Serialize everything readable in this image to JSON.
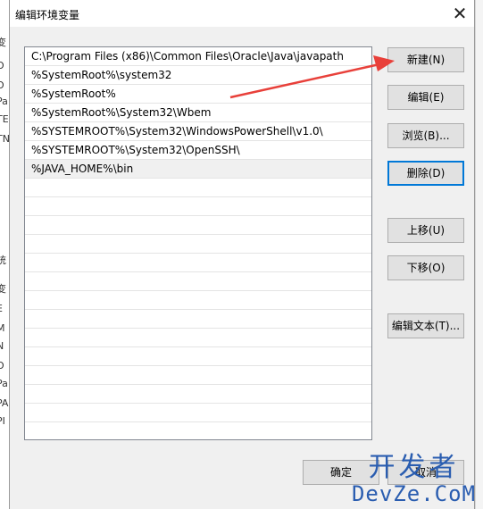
{
  "background_left": [
    "变",
    "O",
    "O",
    "Pa",
    "TE",
    "TN",
    "统",
    "变",
    "E",
    "M",
    "N",
    "O",
    "Pa",
    "PA",
    "PI"
  ],
  "dialog": {
    "title": "编辑环境变量",
    "close_label": "✕",
    "paths": [
      "C:\\Program Files (x86)\\Common Files\\Oracle\\Java\\javapath",
      "%SystemRoot%\\system32",
      "%SystemRoot%",
      "%SystemRoot%\\System32\\Wbem",
      "%SYSTEMROOT%\\System32\\WindowsPowerShell\\v1.0\\",
      "%SYSTEMROOT%\\System32\\OpenSSH\\",
      "%JAVA_HOME%\\bin",
      "",
      "",
      "",
      "",
      "",
      "",
      "",
      "",
      "",
      "",
      "",
      "",
      "",
      ""
    ],
    "buttons": {
      "new": "新建(N)",
      "edit": "编辑(E)",
      "browse": "浏览(B)...",
      "delete": "删除(D)",
      "move_up": "上移(U)",
      "move_down": "下移(O)",
      "edit_text": "编辑文本(T)..."
    },
    "ok": "确定",
    "cancel": "取消"
  },
  "watermark": {
    "top": "开发者",
    "bottom": "DevZe.CoM"
  },
  "colors": {
    "arrow": "#e8403a",
    "focus_border": "#0078d7",
    "watermark": "#2a5db0"
  }
}
